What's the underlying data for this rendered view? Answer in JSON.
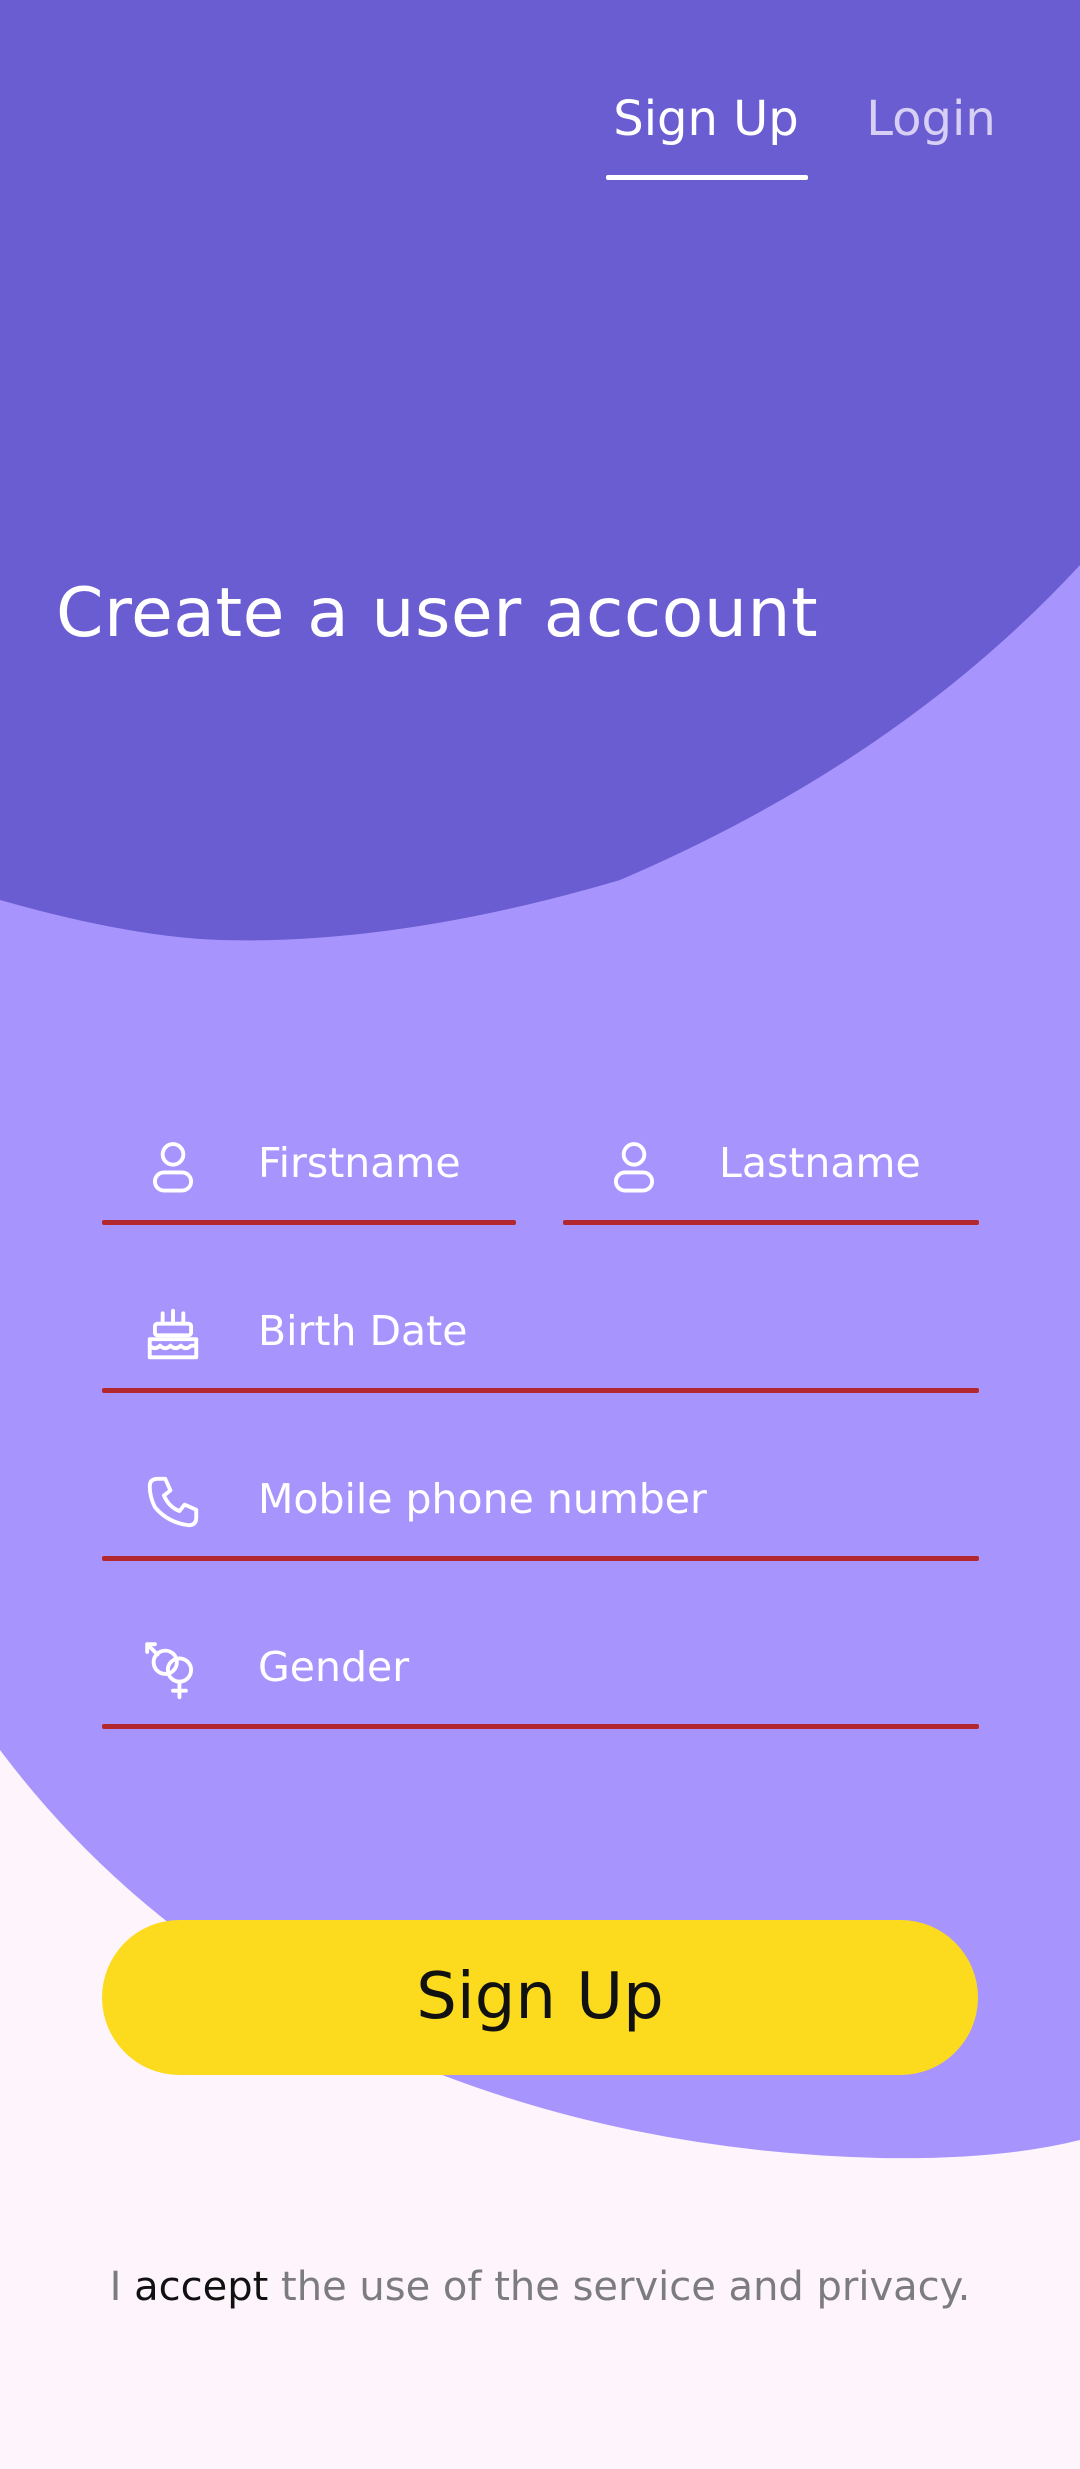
{
  "tabs": {
    "signup_label": "Sign Up",
    "login_label": "Login",
    "active": "Sign Up"
  },
  "header": {
    "title": "Create a user account"
  },
  "form": {
    "firstname_placeholder": "Firstname",
    "lastname_placeholder": "Lastname",
    "birthdate_placeholder": "Birth Date",
    "phone_placeholder": "Mobile phone number",
    "gender_placeholder": "Gender"
  },
  "actions": {
    "signup_button_label": "Sign Up"
  },
  "terms": {
    "prefix": "I ",
    "link_text": "accept",
    "suffix": " the use of the service and privacy."
  },
  "icons": {
    "firstname": "person-icon",
    "lastname": "person-icon",
    "birthdate": "cake-icon",
    "phone": "phone-icon",
    "gender": "gender-icon"
  },
  "colors": {
    "header_purple": "#6a5dd1",
    "body_purple": "#a894fd",
    "background": "#fdf5fb",
    "button_yellow": "#fcdb1f",
    "field_underline": "#b3282e"
  }
}
